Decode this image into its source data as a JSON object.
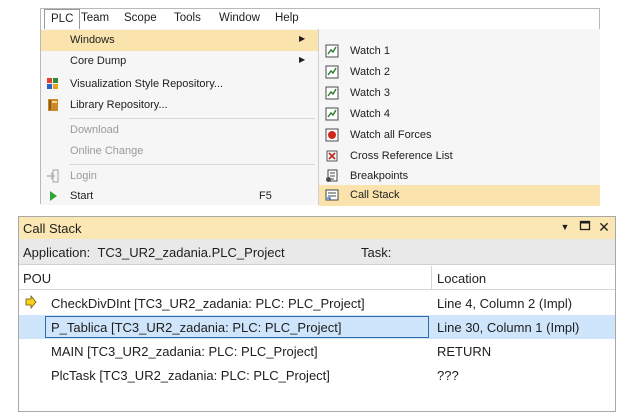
{
  "menubar": {
    "items": [
      "PLC",
      "Team",
      "Scope",
      "Tools",
      "Window",
      "Help"
    ]
  },
  "plc_menu": {
    "items": [
      {
        "label": "Windows"
      },
      {
        "label": "Core Dump"
      },
      {
        "label": "Visualization Style Repository..."
      },
      {
        "label": "Library Repository..."
      },
      {
        "label": "Download"
      },
      {
        "label": "Online Change"
      },
      {
        "label": "Login"
      },
      {
        "label": "Start",
        "shortcut": "F5"
      }
    ]
  },
  "windows_submenu": {
    "items": [
      {
        "label": "Watch 1"
      },
      {
        "label": "Watch 2"
      },
      {
        "label": "Watch 3"
      },
      {
        "label": "Watch 4"
      },
      {
        "label": "Watch all Forces"
      },
      {
        "label": "Cross Reference List"
      },
      {
        "label": "Breakpoints"
      },
      {
        "label": "Call Stack"
      }
    ]
  },
  "callstack": {
    "title": "Call Stack",
    "application_label": "Application:",
    "application_value": "TC3_UR2_zadania.PLC_Project",
    "task_label": "Task:",
    "columns": {
      "pou": "POU",
      "location": "Location"
    },
    "rows": [
      {
        "pou": "CheckDivDInt [TC3_UR2_zadania: PLC: PLC_Project]",
        "location": "Line 4, Column 2 (Impl)"
      },
      {
        "pou": "P_Tablica [TC3_UR2_zadania: PLC: PLC_Project]",
        "location": "Line 30, Column 1 (Impl)"
      },
      {
        "pou": "MAIN [TC3_UR2_zadania: PLC: PLC_Project]",
        "location": "RETURN"
      },
      {
        "pou": "PlcTask [TC3_UR2_zadania: PLC: PLC_Project]",
        "location": "???"
      }
    ]
  },
  "icons": {
    "watch": "watch-window-icon",
    "forces": "watch-all-forces-icon",
    "cross_reference": "cross-reference-icon",
    "breakpoints": "breakpoints-icon",
    "call_stack": "call-stack-icon",
    "visualization": "visualization-style-icon",
    "library": "library-repository-icon",
    "login": "login-icon",
    "start": "start-icon",
    "current_frame": "current-frame-arrow-icon"
  },
  "colors": {
    "highlight": "#fbe3ad",
    "title_bar": "#fbe7b3",
    "selection": "#cfe5fb",
    "selection_border": "#2d6bb3"
  }
}
